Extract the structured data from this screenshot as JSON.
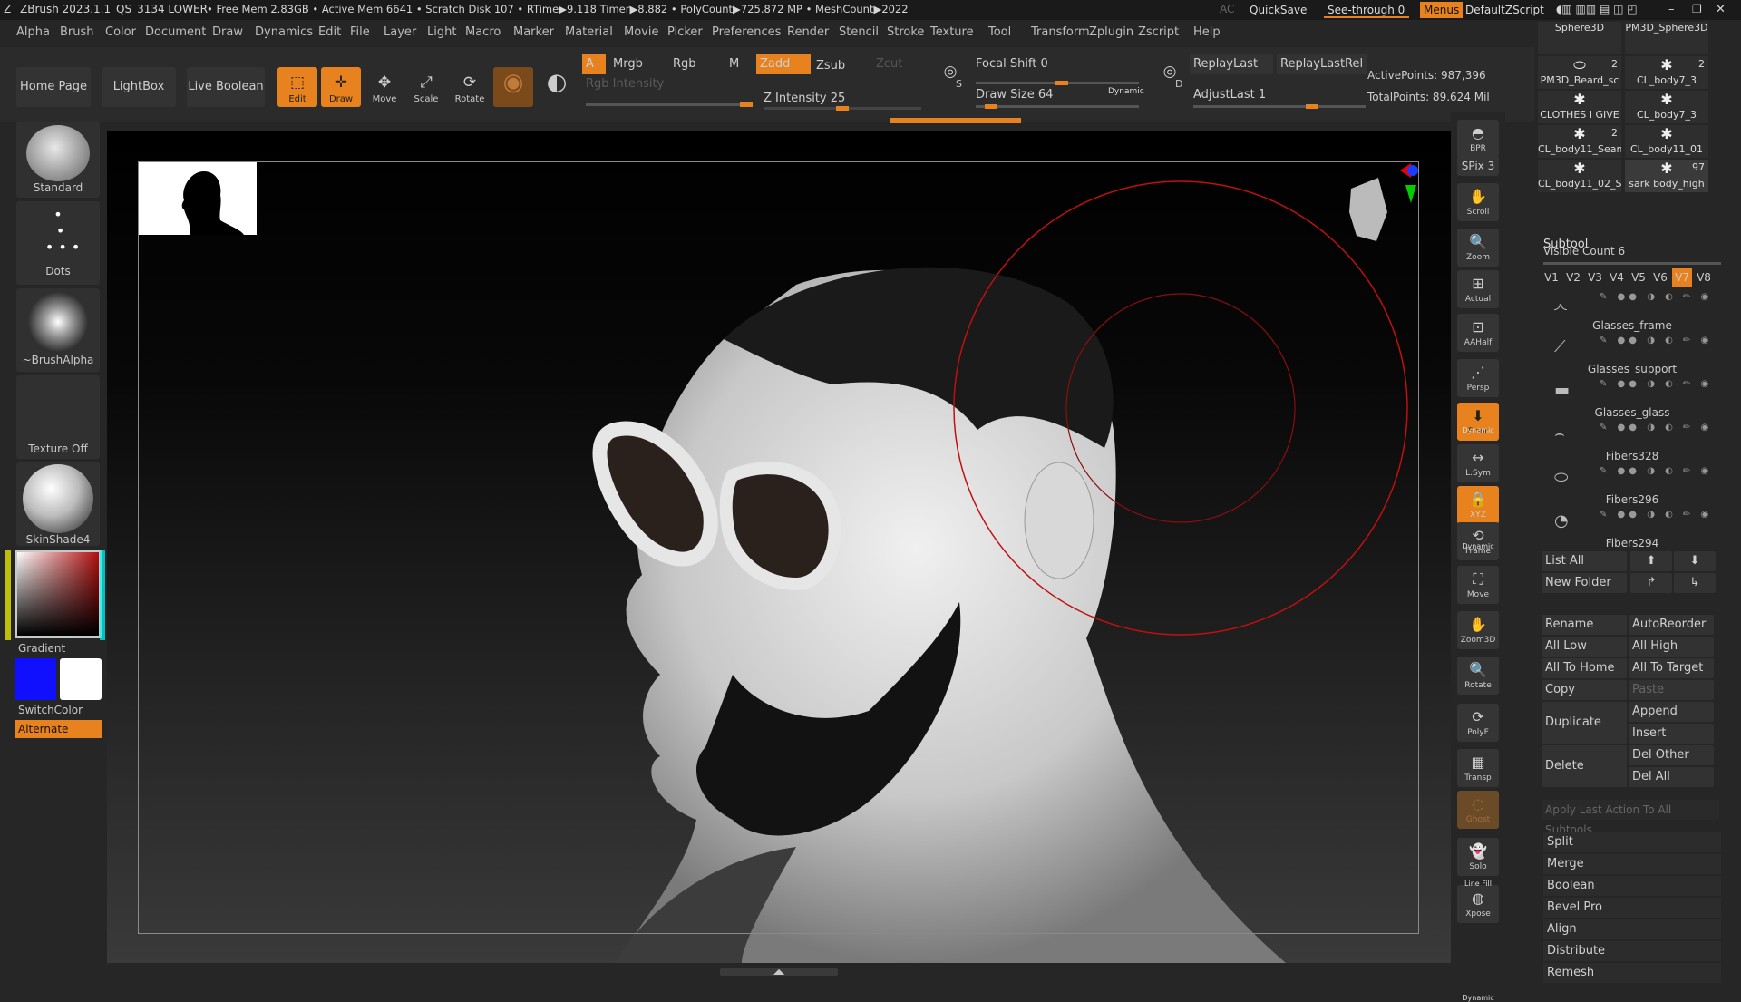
{
  "titlebar": {
    "app": "ZBrush 2023.1.1",
    "doc": "QS_3134 LOWER",
    "stats": "• Free Mem 2.83GB • Active Mem 6641 • Scratch Disk 107 • RTime▶9.118 Timer▶8.882 • PolyCount▶725.872 MP • MeshCount▶2022",
    "ac": "AC",
    "quicksave": "QuickSave",
    "seethrough": "See-through  0",
    "menus": "Menus",
    "script": "DefaultZScript"
  },
  "menus": [
    "Alpha",
    "Brush",
    "Color",
    "Document",
    "Draw",
    "Dynamics",
    "Edit",
    "File",
    "Layer",
    "Light",
    "Macro",
    "Marker",
    "Material",
    "Movie",
    "Picker",
    "Preferences",
    "Render",
    "Stencil",
    "Stroke",
    "Texture",
    "Tool",
    "Transform",
    "Zplugin",
    "Zscript",
    "Help"
  ],
  "toolbar": {
    "home": "Home Page",
    "lightbox": "LightBox",
    "liveboolean": "Live Boolean",
    "edit": "Edit",
    "draw": "Draw",
    "move": "Move",
    "scale": "Scale",
    "rotate": "Rotate",
    "a": "A",
    "mrgb": "Mrgb",
    "rgb": "Rgb",
    "m": "M",
    "zadd": "Zadd",
    "zsub": "Zsub",
    "zcut": "Zcut",
    "rgb_intensity": "Rgb Intensity",
    "z_intensity": "Z Intensity 25",
    "focal_shift": "Focal Shift 0",
    "draw_size": "Draw Size 64",
    "dynamic": "Dynamic",
    "replaylast": "ReplayLast",
    "replaylastrel": "ReplayLastRel",
    "adjustlast": "AdjustLast 1",
    "activepoints": "ActivePoints: 987,396",
    "totalpoints": "TotalPoints: 89.624 Mil",
    "s_label": "S",
    "d_label": "D"
  },
  "left": {
    "brush": "Standard",
    "stroke": "Dots",
    "alpha": "~BrushAlpha",
    "texture": "Texture Off",
    "material": "SkinShade4",
    "gradient": "Gradient",
    "switchcolor": "SwitchColor",
    "alternate": "Alternate",
    "main_color": "#1010ff",
    "secondary_color": "#ffffff"
  },
  "shelf": [
    {
      "label": "BPR",
      "icon": "bpr-icon"
    },
    {
      "label": "SPix 3",
      "icon": "spix-icon"
    },
    {
      "label": "Scroll",
      "icon": "scroll-icon"
    },
    {
      "label": "Zoom",
      "icon": "zoom-icon"
    },
    {
      "label": "Actual",
      "icon": "actual-icon"
    },
    {
      "label": "AAHalf",
      "icon": "aahalf-icon"
    },
    {
      "label": "Persp",
      "icon": "persp-icon"
    },
    {
      "label": "Floor",
      "icon": "floor-icon"
    },
    {
      "label": "L.Sym",
      "icon": "lsym-icon"
    },
    {
      "label": "XYZ",
      "icon": "xyz-icon"
    },
    {
      "label": "Frame",
      "icon": "frame-icon"
    },
    {
      "label": "Move",
      "icon": "move-icon"
    },
    {
      "label": "Zoom3D",
      "icon": "zoom3d-icon"
    },
    {
      "label": "Rotate",
      "icon": "rotate-icon"
    },
    {
      "label": "PolyF",
      "icon": "polyf-icon"
    },
    {
      "label": "Transp",
      "icon": "transp-icon"
    },
    {
      "label": "Ghost",
      "icon": "ghost-icon"
    },
    {
      "label": "Solo",
      "icon": "solo-icon"
    },
    {
      "label": "Xpose",
      "icon": "xpose-icon"
    }
  ],
  "shelf_tags": {
    "dynamic": "Dynamic",
    "linefill": "Line Fill"
  },
  "tools": [
    {
      "name": "Sphere3D",
      "count": ""
    },
    {
      "name": "PM3D_Sphere3D",
      "count": ""
    },
    {
      "name": "PM3D_Beard_sc",
      "count": "2"
    },
    {
      "name": "CL_body7_3",
      "count": "2"
    },
    {
      "name": "CLOTHES I GIVE",
      "count": ""
    },
    {
      "name": "CL_body7_3",
      "count": ""
    },
    {
      "name": "CL_body11_Sean",
      "count": "2"
    },
    {
      "name": "CL_body11_01",
      "count": ""
    },
    {
      "name": "CL_body11_02_S",
      "count": ""
    },
    {
      "name": "sark body_high",
      "count": "97"
    }
  ],
  "subtool": {
    "title": "Subtool",
    "visible": "Visible Count 6",
    "tabs": [
      "V1",
      "V2",
      "V3",
      "V4",
      "V5",
      "V6",
      "V7",
      "V8"
    ],
    "active_tab": "V7",
    "items": [
      "Glasses_frame",
      "Glasses_support",
      "Glasses_glass",
      "Fibers328",
      "Fibers296",
      "Fibers294"
    ],
    "listall": "List All",
    "newfolder": "New Folder",
    "buttons": {
      "rename": "Rename",
      "autoreorder": "AutoReorder",
      "alllow": "All Low",
      "allhigh": "All High",
      "alltohome": "All To Home",
      "alltotarget": "All To Target",
      "copy": "Copy",
      "paste": "Paste",
      "duplicate": "Duplicate",
      "append": "Append",
      "insert": "Insert",
      "delete": "Delete",
      "delother": "Del Other",
      "delall": "Del All",
      "applylast": "Apply Last Action To All Subtools"
    },
    "rows": [
      "Split",
      "Merge",
      "Boolean",
      "Bevel Pro",
      "Align",
      "Distribute",
      "Remesh"
    ]
  }
}
